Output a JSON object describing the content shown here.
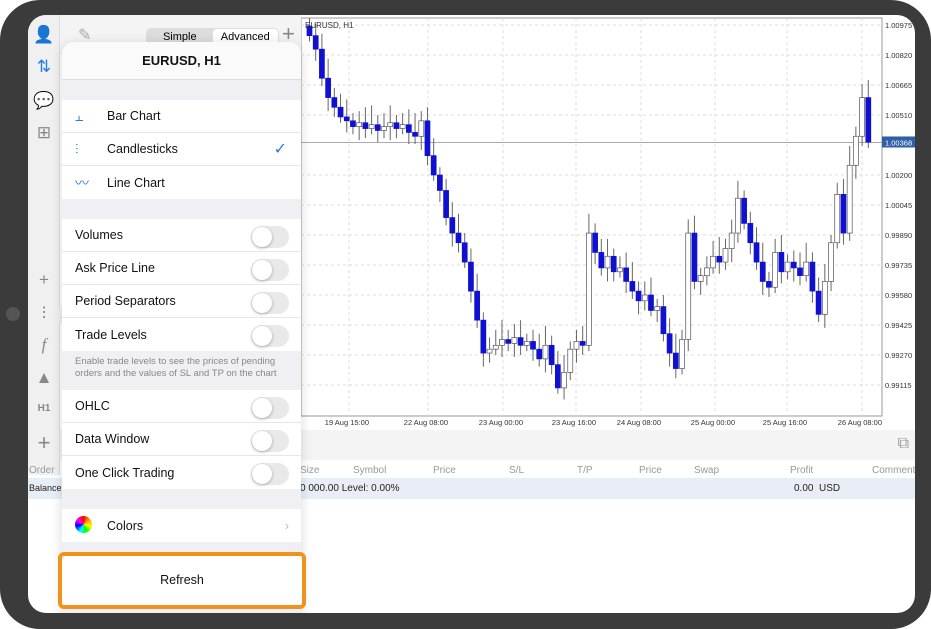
{
  "toolbar": {
    "simple": "Simple",
    "advanced": "Advanced"
  },
  "chart": {
    "symbol": "EURUSD, H1",
    "current_price": "1.00368",
    "price_ticks": [
      "1.00975",
      "1.00820",
      "1.00665",
      "1.00510",
      "1.00200",
      "1.00045",
      "0.99890",
      "0.99735",
      "0.99580",
      "0.99425",
      "0.99270",
      "0.99115"
    ],
    "time_ticks": [
      "19 Aug 15:00",
      "22 Aug 08:00",
      "23 Aug 00:00",
      "23 Aug 16:00",
      "24 Aug 08:00",
      "25 Aug 00:00",
      "25 Aug 16:00",
      "26 Aug 08:00"
    ],
    "closes": [
      1.0092,
      1.0085,
      1.007,
      1.006,
      1.0055,
      1.005,
      1.0048,
      1.0045,
      1.0047,
      1.0044,
      1.0046,
      1.0043,
      1.0045,
      1.0047,
      1.0044,
      1.0046,
      1.0042,
      1.004,
      1.0048,
      1.003,
      1.002,
      1.0012,
      0.9998,
      0.999,
      0.9985,
      0.9975,
      0.996,
      0.9945,
      0.9928,
      0.993,
      0.9932,
      0.9935,
      0.9933,
      0.9936,
      0.9932,
      0.9934,
      0.993,
      0.9925,
      0.9932,
      0.9922,
      0.991,
      0.9918,
      0.993,
      0.9934,
      0.9932,
      0.999,
      0.998,
      0.9972,
      0.9978,
      0.997,
      0.9972,
      0.9965,
      0.996,
      0.9955,
      0.9958,
      0.995,
      0.9952,
      0.9938,
      0.9928,
      0.992,
      0.9935,
      0.999,
      0.9965,
      0.9968,
      0.9972,
      0.9978,
      0.9975,
      0.9982,
      0.999,
      1.0008,
      0.9995,
      0.9985,
      0.9975,
      0.9965,
      0.9962,
      0.998,
      0.997,
      0.9975,
      0.9972,
      0.9968,
      0.9975,
      0.996,
      0.9948,
      0.9965,
      0.9985,
      1.001,
      0.999,
      1.0025,
      1.004,
      1.006,
      1.0037
    ]
  },
  "sidebar": {
    "timeframe": "H1"
  },
  "menu": {
    "title": "EURUSD, H1",
    "chart_types": [
      {
        "label": "Bar Chart",
        "icon": "bar-chart-icon"
      },
      {
        "label": "Candlesticks",
        "icon": "candlestick-icon",
        "selected": true
      },
      {
        "label": "Line Chart",
        "icon": "line-chart-icon"
      }
    ],
    "toggles1": [
      {
        "label": "Volumes",
        "on": false
      },
      {
        "label": "Ask Price Line",
        "on": false
      },
      {
        "label": "Period Separators",
        "on": false
      },
      {
        "label": "Trade Levels",
        "on": false
      }
    ],
    "note": "Enable trade levels to see the prices of pending orders and the values of SL and TP on the chart",
    "toggles2": [
      {
        "label": "OHLC",
        "on": false
      },
      {
        "label": "Data Window",
        "on": false
      },
      {
        "label": "One Click Trading",
        "on": false
      }
    ],
    "colors": "Colors",
    "refresh": "Refresh"
  },
  "table": {
    "headers": [
      "Order",
      "Size",
      "Symbol",
      "Price",
      "S/L",
      "T/P",
      "Price",
      "Swap",
      "Profit",
      "Comment"
    ],
    "balance_label": "Balance",
    "balance_text": "0 000.00 Level: 0.00%",
    "profit": "0.00",
    "currency": "USD"
  },
  "colors": {
    "bear": "#1010d0",
    "highlight": "#f0921e",
    "accent": "#2d7be5"
  }
}
